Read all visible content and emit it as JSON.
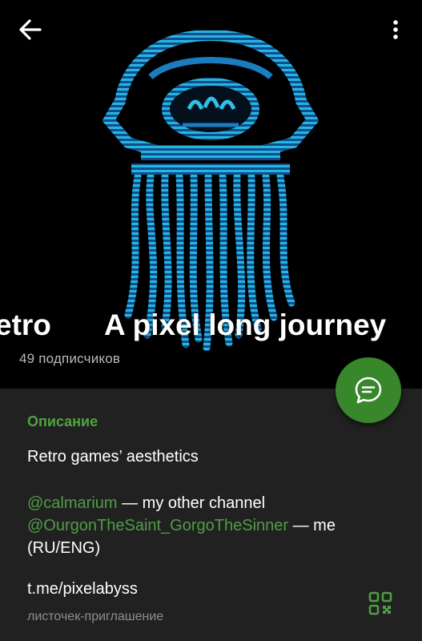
{
  "header": {
    "back_icon": "arrow-left-icon",
    "menu_icon": "more-vertical-icon"
  },
  "channel": {
    "title_left": "etro",
    "title_right": "A pixel long journey",
    "subscribers": "49 подписчиков"
  },
  "fab": {
    "icon": "message-bubble-icon"
  },
  "description": {
    "section_title": "Описание",
    "line1": "Retro games’ aesthetics",
    "mention1": "@calmarium",
    "mention1_text": " — my other channel",
    "mention2": "@OurgonTheSaint_GorgoTheSinner",
    "mention2_text": " — me (RU/ENG)"
  },
  "invite": {
    "link": "t.me/pixelabyss",
    "caption": "листочек-приглашение",
    "qr_icon": "qr-code-icon"
  },
  "colors": {
    "accent_green": "#38872b",
    "link_green": "#4f9d45",
    "panel_bg": "#212121",
    "art_cyan": "#1fa9d6"
  }
}
